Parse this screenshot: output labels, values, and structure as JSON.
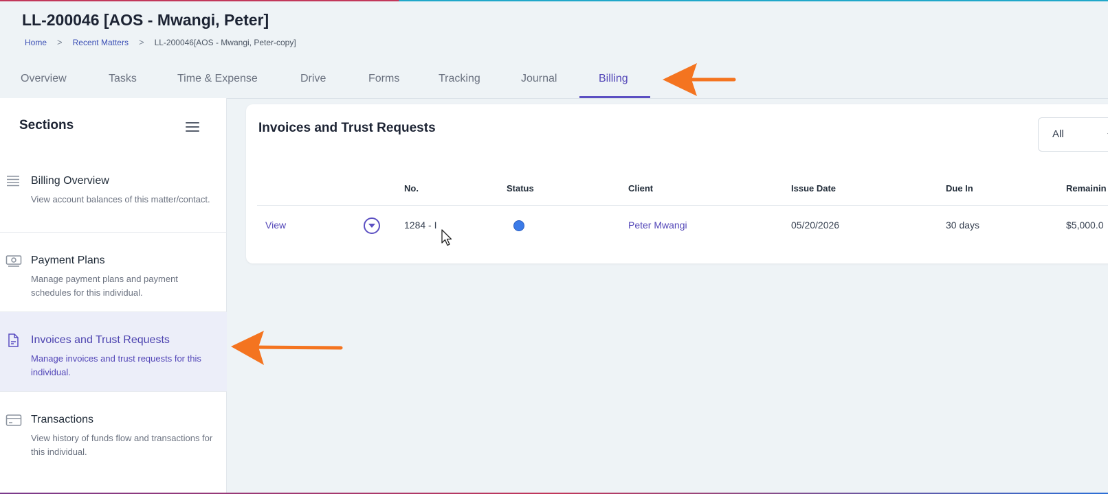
{
  "header": {
    "title": "LL-200046 [AOS - Mwangi, Peter]",
    "breadcrumb": {
      "items": [
        "Home",
        "Recent Matters"
      ],
      "current": "LL-200046[AOS - Mwangi, Peter-copy]",
      "separator": ">"
    }
  },
  "tabs": [
    {
      "label": "Overview"
    },
    {
      "label": "Tasks"
    },
    {
      "label": "Time & Expense"
    },
    {
      "label": "Drive"
    },
    {
      "label": "Forms"
    },
    {
      "label": "Tracking"
    },
    {
      "label": "Journal"
    },
    {
      "label": "Billing",
      "active": true
    }
  ],
  "sidebar": {
    "title": "Sections",
    "items": [
      {
        "label": "Billing Overview",
        "description": "View account balances of this matter/contact.",
        "icon": "list-icon"
      },
      {
        "label": "Payment Plans",
        "description": "Manage payment plans and payment schedules for this individual.",
        "icon": "cash-icon"
      },
      {
        "label": "Invoices and Trust Requests",
        "description": "Manage invoices and trust requests for this individual.",
        "icon": "document-icon",
        "active": true
      },
      {
        "label": "Transactions",
        "description": "View history of funds flow and transactions for this individual.",
        "icon": "card-icon"
      }
    ]
  },
  "main": {
    "title": "Invoices and Trust Requests",
    "filter": {
      "value": "All"
    },
    "table": {
      "columns": [
        "No.",
        "Status",
        "Client",
        "Issue Date",
        "Due In",
        "Remainin"
      ],
      "rows": [
        {
          "action": "View",
          "no": "1284 - I",
          "status_color": "#3b7be8",
          "client": "Peter Mwangi",
          "issue_date": "05/20/2026",
          "due_in": "30 days",
          "remaining": "$5,000.0"
        }
      ]
    }
  },
  "colors": {
    "accent": "#5b4fc2",
    "annotation_arrow": "#f47420",
    "active_section_bg": "#eceef9"
  }
}
